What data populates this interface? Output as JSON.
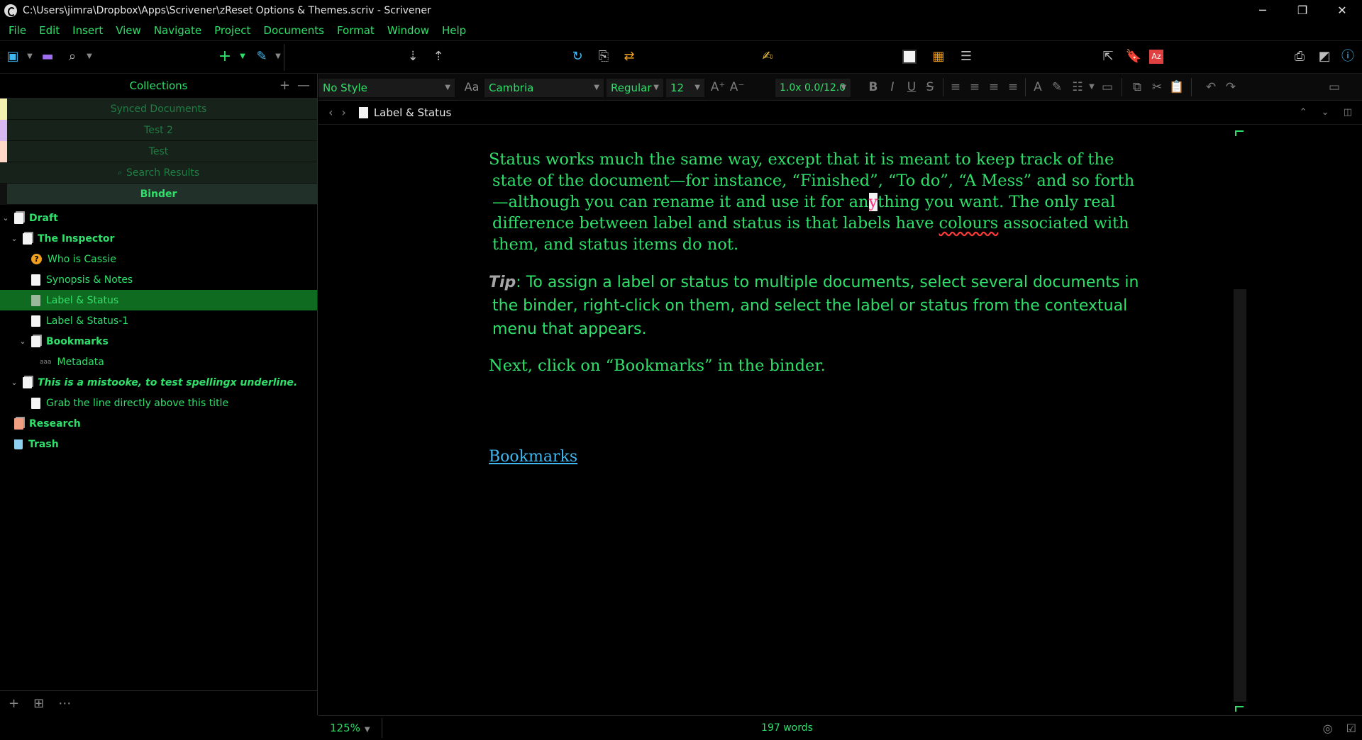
{
  "window": {
    "title": "C:\\Users\\jimra\\Dropbox\\Apps\\Scrivener\\zReset Options & Themes.scriv - Scrivener",
    "minimize": "─",
    "restore": "❐",
    "close": "✕"
  },
  "menu": [
    "File",
    "Edit",
    "Insert",
    "View",
    "Navigate",
    "Project",
    "Documents",
    "Format",
    "Window",
    "Help"
  ],
  "collections": {
    "header": "Collections",
    "add": "+",
    "remove": "—",
    "tabs": [
      {
        "label": "Synced Documents",
        "color": "#f6f0b0"
      },
      {
        "label": "Test 2",
        "color": "#d8b8f0"
      },
      {
        "label": "Test",
        "color": "#ffd8c8"
      },
      {
        "label": "Search Results",
        "color": "#22302a"
      },
      {
        "label": "Binder",
        "color": "#111111"
      }
    ]
  },
  "binder": {
    "items": [
      {
        "label": "Draft"
      },
      {
        "label": "The Inspector"
      },
      {
        "label": "Who is Cassie"
      },
      {
        "label": "Synopsis & Notes"
      },
      {
        "label": "Label & Status"
      },
      {
        "label": "Label & Status-1"
      },
      {
        "label": "Bookmarks"
      },
      {
        "label": "Metadata"
      },
      {
        "label": "This is a mistooke, to test spellingx underline."
      },
      {
        "label": "Grab the line directly above this title"
      },
      {
        "label": "Research"
      },
      {
        "label": "Trash"
      }
    ]
  },
  "formatbar": {
    "style": "No Style",
    "font": "Cambria",
    "weight": "Regular",
    "size": "12",
    "spacing": "1.0x 0.0/12.0"
  },
  "header": {
    "doc_title": "Label & Status"
  },
  "editor": {
    "p1_a": "Status works much the same way, except that it is meant to keep track of the state of the document—for instance, “Finished”, “To do”, “A Mess” and so forth—although you can rename it and use it for an",
    "p1_caret": "y",
    "p1_b": "thing you want. The only real difference between label and status is that labels have ",
    "p1_misspelled": "colours",
    "p1_c": " associated with them, and status items do not.",
    "tip_label": "Tip",
    "tip_text": ": To assign a label or status to multiple documents, select several documents in the binder, right-click on them, and select the label or status from the contextual menu that appears.",
    "p3": "Next, click on “Bookmarks” in the binder.",
    "link": "Bookmarks"
  },
  "footer": {
    "zoom": "125%",
    "word_count": "197 words"
  },
  "colors": {
    "text_green": "#2ee06a",
    "selection_green": "#0f6b1f",
    "link_blue": "#3fb7f0"
  }
}
